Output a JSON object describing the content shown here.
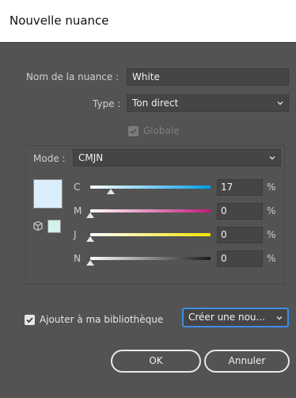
{
  "window": {
    "title": "Nouvelle nuance"
  },
  "swatch_name": {
    "label": "Nom de la nuance :",
    "value": "White"
  },
  "type": {
    "label": "Type :",
    "value": "Ton direct"
  },
  "global": {
    "label": "Globale",
    "checked": true,
    "disabled": true
  },
  "mode": {
    "label": "Mode :",
    "value": "CMJN"
  },
  "channels": [
    {
      "label": "C",
      "value": "17",
      "unit": "%",
      "fraction": 0.17
    },
    {
      "label": "M",
      "value": "0",
      "unit": "%",
      "fraction": 0
    },
    {
      "label": "J",
      "value": "0",
      "unit": "%",
      "fraction": 0
    },
    {
      "label": "N",
      "value": "0",
      "unit": "%",
      "fraction": 0
    }
  ],
  "library": {
    "label": "Ajouter à ma bibliothèque",
    "checked": true,
    "target": "Créer une nou..."
  },
  "buttons": {
    "ok": "OK",
    "cancel": "Annuler"
  },
  "colors": {
    "swatch_fill": "#dbeefb",
    "gamut_swatch": "#d4f0ea",
    "cyan_track_end": "#00a0e9",
    "magenta_track_end": "#c2187a",
    "yellow_track_end": "#f2e500",
    "black_track_end": "#1a1a1a"
  }
}
